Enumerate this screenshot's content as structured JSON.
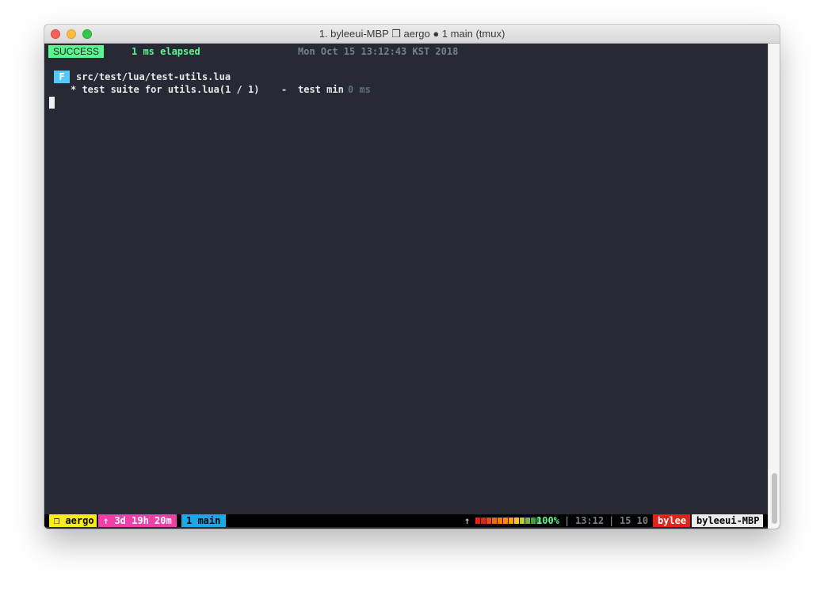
{
  "window": {
    "title": "1. byleeui-MBP ❒ aergo ● 1 main (tmux)"
  },
  "result": {
    "status": "SUCCESS",
    "elapsed": "1 ms elapsed",
    "datetime": "Mon Oct 15 13:12:43 KST 2018"
  },
  "test_file": {
    "badge": "F",
    "path": "src/test/lua/test-utils.lua",
    "suite_line": "* test suite for utils.lua(1 / 1)",
    "dash": "-",
    "test_name": "test min",
    "test_time": "0 ms"
  },
  "statusbar": {
    "session": "❒ aergo",
    "uptime": "↑ 3d 19h 20m",
    "window": "1 main",
    "arrow": "↑",
    "battery_percent_text": "100%",
    "battery_level": 1.0,
    "battery_colors": [
      "#e2231a",
      "#e2231a",
      "#e64a19",
      "#ef6c00",
      "#f57c00",
      "#fb8c00",
      "#ffa000",
      "#fbc02d",
      "#c0ca33",
      "#7cb342",
      "#43a047",
      "#2e7d32"
    ],
    "sep": "|",
    "clock": "13:12",
    "date": "15 10",
    "user": "bylee",
    "host": "byleeui-MBP"
  },
  "colors": {
    "terminal_bg": "#272a34",
    "success": "#5af78e",
    "badge_blue": "#57c7ff",
    "session_yellow": "#f8ec17",
    "uptime_pink": "#f13fa8",
    "window_blue": "#1ba8e8",
    "user_red": "#e2231a"
  }
}
